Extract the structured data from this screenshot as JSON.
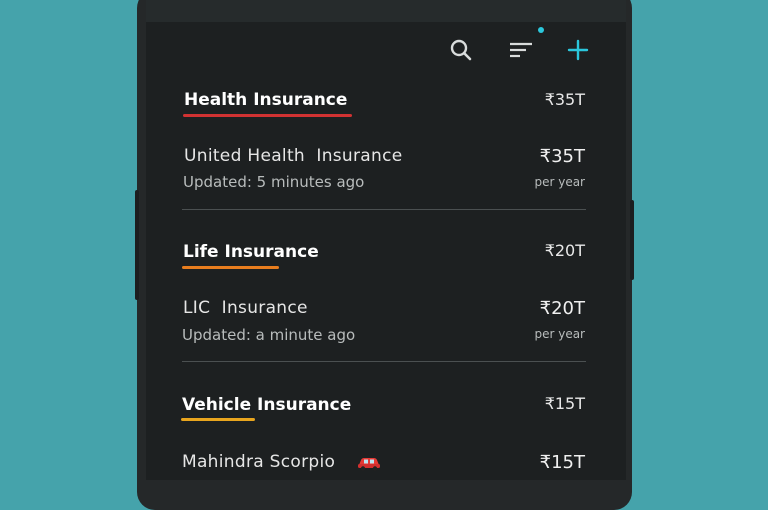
{
  "toolbar": {
    "search_icon": "search-icon",
    "filter_icon": "filter-icon",
    "add_icon": "plus-icon",
    "accent_color": "#2bc7dc",
    "filter_has_notification": true
  },
  "sections": [
    {
      "title": "Health Insurance",
      "total": "₹35T",
      "underline_color": "#d13232",
      "item": {
        "name": "United Health  Insurance",
        "updated": "Updated: 5 minutes ago",
        "amount": "₹35T",
        "period": "per year"
      }
    },
    {
      "title": "Life Insurance",
      "total": "₹20T",
      "underline_color": "#e87d1e",
      "item": {
        "name": "LIC  Insurance",
        "updated": "Updated: a minute ago",
        "amount": "₹20T",
        "period": "per year"
      }
    },
    {
      "title": "Vehicle Insurance",
      "total": "₹15T",
      "underline_color": "#e8a51e",
      "item": {
        "name": "Mahindra Scorpio",
        "icon": "car-icon",
        "amount": "₹15T"
      }
    }
  ]
}
